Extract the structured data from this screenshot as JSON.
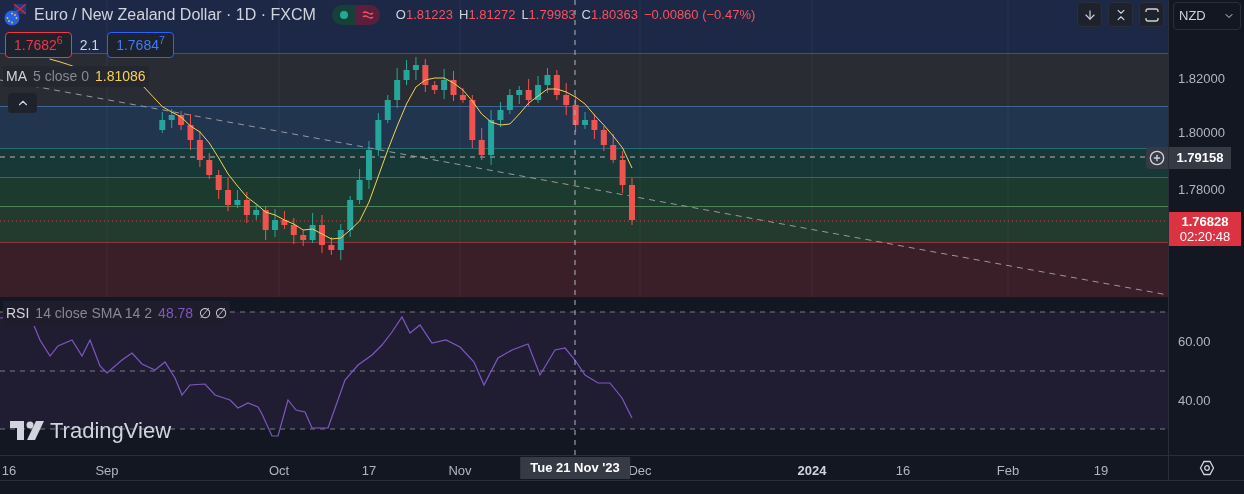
{
  "header": {
    "title": "Euro / New Zealand Dollar · 1D · FXCM",
    "market_open": true,
    "ohlc": [
      {
        "label": "O",
        "value": "1.81223"
      },
      {
        "label": "H",
        "value": "1.81272"
      },
      {
        "label": "L",
        "value": "1.79983"
      },
      {
        "label": "C",
        "value": "1.80363"
      }
    ],
    "change": "−0.00860 (−0.47%)"
  },
  "quote": {
    "sell": "1.7682$^{6}$",
    "spread": "2.1",
    "buy": "1.7684$^{7}$"
  },
  "ma_legend": {
    "name": "MA",
    "params": "5 close 0",
    "value": "1.81086"
  },
  "currency": "NZD",
  "price_axis": {
    "ticks": [
      "1.82000",
      "1.80000",
      "1.78000"
    ],
    "crosshair_price": "1.79158",
    "last_price": "1.76828",
    "countdown": "02:20:48"
  },
  "rsi_legend": {
    "name": "RSI",
    "params": "14 close SMA 14 2",
    "value": "48.78",
    "extras": "∅ ∅"
  },
  "rsi_axis": {
    "ticks": [
      "60.00",
      "40.00"
    ]
  },
  "logo": "TradingView",
  "time_axis": {
    "labels": [
      {
        "text": "16",
        "kind": "tick"
      },
      {
        "text": "Sep",
        "kind": "tick"
      },
      {
        "text": "Oct",
        "kind": "tick"
      },
      {
        "text": "17",
        "kind": "tick"
      },
      {
        "text": "Nov",
        "kind": "tick"
      },
      {
        "text": "Dec",
        "kind": "tick"
      },
      {
        "text": "2024",
        "kind": "year"
      },
      {
        "text": "16",
        "kind": "tick"
      },
      {
        "text": "Feb",
        "kind": "tick"
      },
      {
        "text": "19",
        "kind": "tick"
      }
    ],
    "crosshair_time": "Tue 21 Nov '23"
  }
}
